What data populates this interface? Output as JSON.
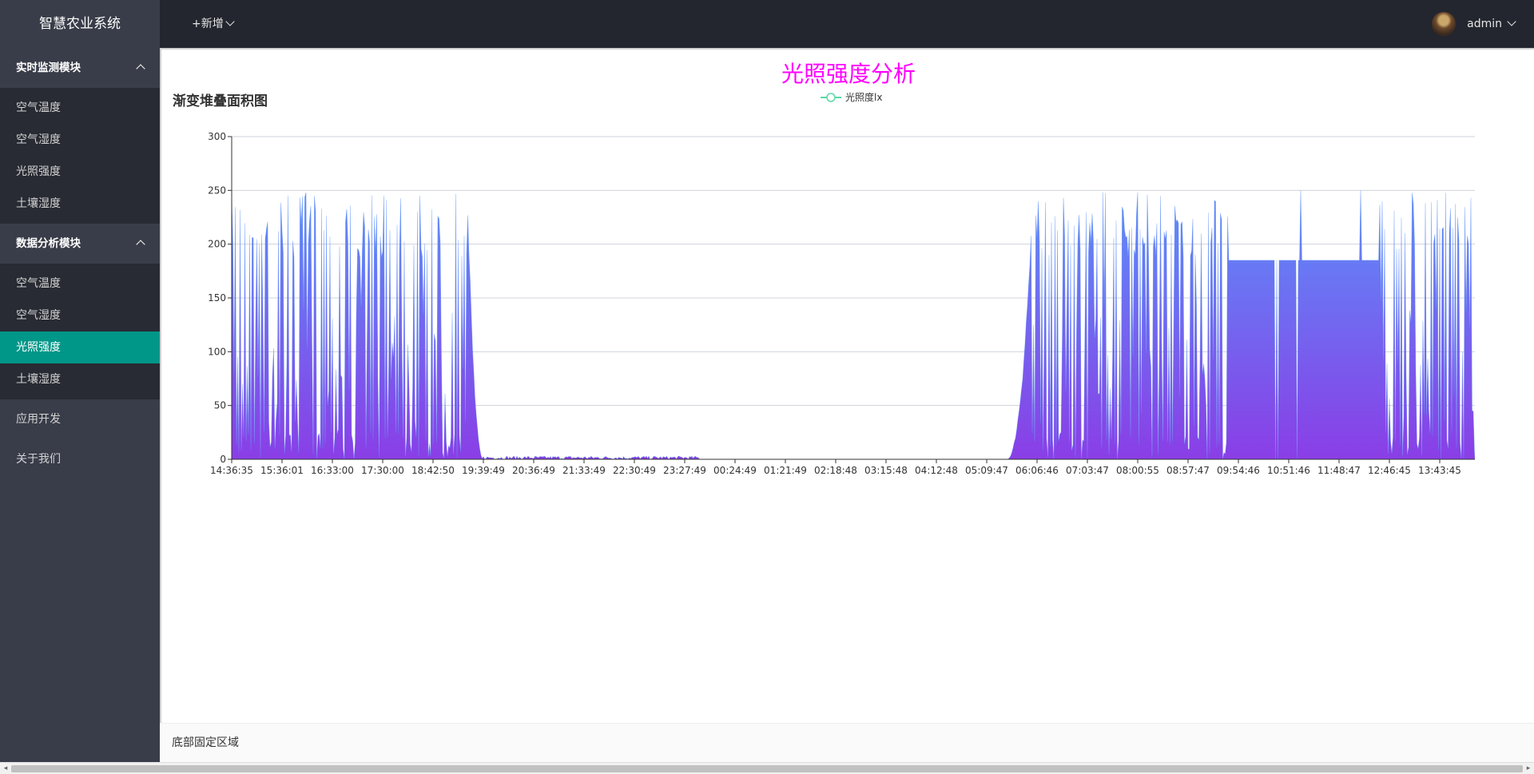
{
  "app": {
    "title": "智慧农业系统"
  },
  "topbar": {
    "add_label": "+新增",
    "user_name": "admin"
  },
  "sidebar": {
    "groups": [
      {
        "label": "实时监测模块",
        "items": [
          "空气温度",
          "空气湿度",
          "光照强度",
          "土壤湿度"
        ]
      },
      {
        "label": "数据分析模块",
        "items": [
          "空气温度",
          "空气湿度",
          "光照强度",
          "土壤湿度"
        ],
        "active_index": 2
      }
    ],
    "extra": [
      "应用开发",
      "关于我们"
    ]
  },
  "main": {
    "section_title": "渐变堆叠面积图"
  },
  "footer": {
    "text": "底部固定区域"
  },
  "colors": {
    "accent": "#009688",
    "title": "#ff00ff",
    "area_top": "#5b8ff9",
    "area_bottom": "#8a3ee6",
    "legend_line": "#5ad8a6"
  },
  "chart_data": {
    "type": "area",
    "title": "光照强度分析",
    "legend": "光照度lx",
    "legend_position": "top-center",
    "grid": true,
    "ylim": [
      0,
      300
    ],
    "y_ticks": [
      0,
      50,
      100,
      150,
      200,
      250,
      300
    ],
    "x_tick_labels": [
      "14:36:35",
      "15:36:01",
      "16:33:00",
      "17:30:00",
      "18:42:50",
      "19:39:49",
      "20:36:49",
      "21:33:49",
      "22:30:49",
      "23:27:49",
      "00:24:49",
      "01:21:49",
      "02:18:48",
      "03:15:48",
      "04:12:48",
      "05:09:47",
      "06:06:46",
      "07:03:47",
      "08:00:55",
      "08:57:47",
      "09:54:46",
      "10:51:46",
      "11:48:47",
      "12:46:45",
      "13:43:45"
    ],
    "series": [
      {
        "name": "光照度lx",
        "segments": [
          {
            "from_tick": 0,
            "to_tick": 4.7,
            "pattern": "fluctuating",
            "min": 0,
            "max": 250
          },
          {
            "from_tick": 4.7,
            "to_tick": 5.0,
            "pattern": "decline",
            "min": 0,
            "max": 230
          },
          {
            "from_tick": 5.0,
            "to_tick": 9.3,
            "pattern": "low",
            "min": 0,
            "max": 3
          },
          {
            "from_tick": 9.3,
            "to_tick": 15.4,
            "pattern": "zero",
            "min": 0,
            "max": 0
          },
          {
            "from_tick": 15.4,
            "to_tick": 15.9,
            "pattern": "rise",
            "min": 0,
            "max": 240
          },
          {
            "from_tick": 15.9,
            "to_tick": 19.8,
            "pattern": "fluctuating",
            "min": 0,
            "max": 250
          },
          {
            "from_tick": 19.8,
            "to_tick": 22.8,
            "pattern": "flat",
            "min": 185,
            "max": 185
          },
          {
            "from_tick": 22.8,
            "to_tick": 24.75,
            "pattern": "fluctuating",
            "min": 0,
            "max": 250
          }
        ]
      }
    ]
  }
}
